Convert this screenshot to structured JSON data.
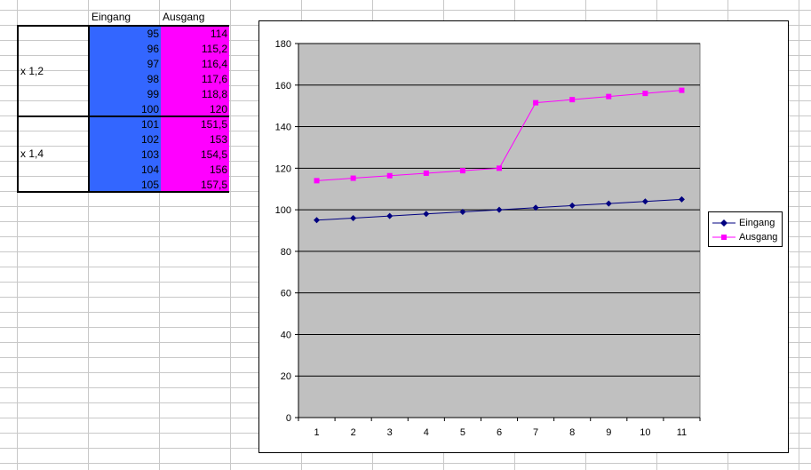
{
  "sheet": {
    "headers": {
      "eingang": "Eingang",
      "ausgang": "Ausgang"
    },
    "groups": [
      {
        "label": "x 1,2",
        "rows": [
          {
            "eingang": "95",
            "ausgang": "114"
          },
          {
            "eingang": "96",
            "ausgang": "115,2"
          },
          {
            "eingang": "97",
            "ausgang": "116,4"
          },
          {
            "eingang": "98",
            "ausgang": "117,6"
          },
          {
            "eingang": "99",
            "ausgang": "118,8"
          },
          {
            "eingang": "100",
            "ausgang": "120"
          }
        ]
      },
      {
        "label": "x 1,4",
        "rows": [
          {
            "eingang": "101",
            "ausgang": "151,5"
          },
          {
            "eingang": "102",
            "ausgang": "153"
          },
          {
            "eingang": "103",
            "ausgang": "154,5"
          },
          {
            "eingang": "104",
            "ausgang": "156"
          },
          {
            "eingang": "105",
            "ausgang": "157,5"
          }
        ]
      }
    ],
    "colors": {
      "eingang_fill": "#3366ff",
      "ausgang_fill": "#ff00ff",
      "grid": "#c8c8c8"
    }
  },
  "chart_data": {
    "type": "line",
    "x": [
      1,
      2,
      3,
      4,
      5,
      6,
      7,
      8,
      9,
      10,
      11
    ],
    "ylim": [
      0,
      180
    ],
    "yticks": [
      0,
      20,
      40,
      60,
      80,
      100,
      120,
      140,
      160,
      180
    ],
    "grid": true,
    "plot_background": "#c0c0c0",
    "legend_position": "right",
    "series": [
      {
        "name": "Eingang",
        "color": "#000080",
        "marker": "diamond",
        "values": [
          95,
          96,
          97,
          98,
          99,
          100,
          101,
          102,
          103,
          104,
          105
        ]
      },
      {
        "name": "Ausgang",
        "color": "#ff00ff",
        "marker": "square",
        "values": [
          114,
          115.2,
          116.4,
          117.6,
          118.8,
          120,
          151.5,
          153,
          154.5,
          156,
          157.5
        ]
      }
    ]
  }
}
